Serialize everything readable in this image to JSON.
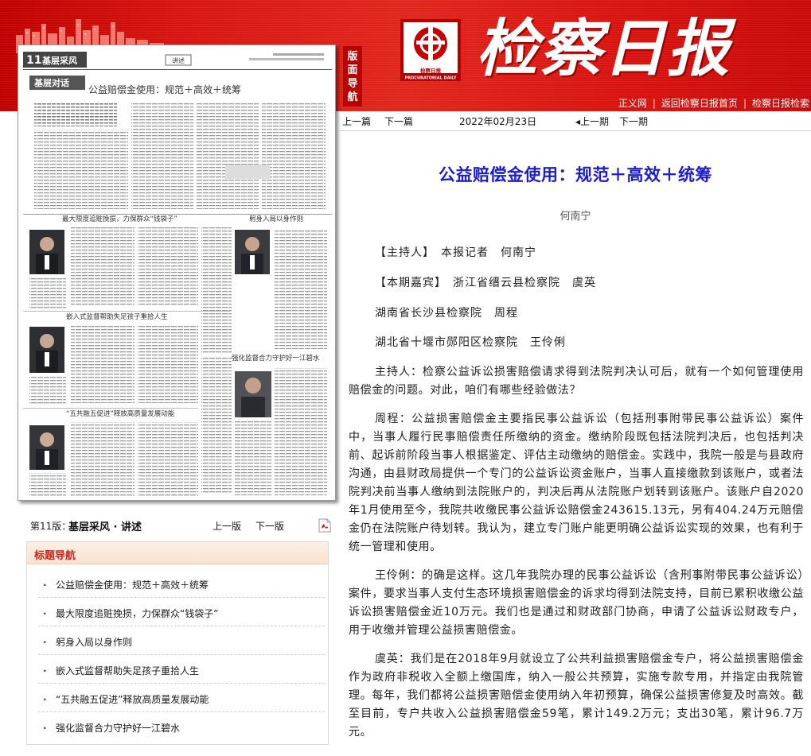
{
  "header": {
    "masthead": "检察日报",
    "logo_caption": "检察日报",
    "logo_caption_en": "PROCURATORIAL DAILY",
    "side_tab": "版面导航",
    "links": [
      "正义网",
      "返回检察日报首页",
      "检察日报检索"
    ]
  },
  "colors": {
    "header_red": "#d81410",
    "title_blue": "#1d1dcf",
    "nav_title_red": "#c8231b"
  },
  "top_nav": {
    "prev_article": "上一篇",
    "next_article": "下一篇",
    "date": "2022年02月23日",
    "prev_issue": "上一期",
    "next_issue": "下一期"
  },
  "thumbnail": {
    "page_no": "11",
    "section_name": "基层采风",
    "tag": "讲述",
    "sub_section": "基层对话",
    "headlines": [
      "公益赔偿金使用：规范＋高效＋统筹",
      "最大限度追赃挽损，力保群众“钱袋子”",
      "躬身入局以身作则",
      "嵌入式监督帮助失足孩子重拾人生",
      "强化监督合力守护好一江碧水",
      "“五共融五促进”释放高质量发展动能"
    ]
  },
  "page_info": {
    "label": "第11版：",
    "name": "基层采风 · 讲述",
    "prev": "上一版",
    "next": "下一版",
    "pdf_icon": "pdf-icon"
  },
  "title_nav": {
    "header": "标题导航",
    "items": [
      "公益赔偿金使用：规范＋高效＋统筹",
      "最大限度追赃挽损，力保群众“钱袋子”",
      "躬身入局以身作则",
      "嵌入式监督帮助失足孩子重拾人生",
      "“五共融五促进”释放高质量发展动能",
      "强化监督合力守护好一江碧水"
    ]
  },
  "article": {
    "title": "公益赔偿金使用：规范＋高效＋统筹",
    "author": "何南宁",
    "host_line": "【主持人】　本报记者　何南宁",
    "guests_line": "【本期嘉宾】　浙江省缙云县检察院　虞英",
    "guest2": "湖南省长沙县检察院　周程",
    "guest3": "湖北省十堰市郧阳区检察院　王伶俐",
    "paragraphs": [
      "主持人：检察公益诉讼损害赔偿请求得到法院判决认可后，就有一个如何管理使用赔偿金的问题。对此，咱们有哪些经验做法？",
      "周程：公益损害赔偿金主要指民事公益诉讼（包括刑事附带民事公益诉讼）案件中，当事人履行民事赔偿责任所缴纳的资金。缴纳阶段既包括法院判决后，也包括判决前、起诉前阶段当事人根据鉴定、评估主动缴纳的赔偿金。实践中，我院一般是与县政府沟通，由县财政局提供一个专门的公益诉讼资金账户，当事人直接缴款到该账户，或者法院判决前当事人缴纳到法院账户的，判决后再从法院账户划转到该账户。该账户自2020年1月使用至今，我院共收缴民事公益诉讼赔偿金243615.13元，另有404.24万元赔偿金仍在法院账户待划转。我认为，建立专门账户能更明确公益诉讼实现的效果，也有利于统一管理和使用。",
      "王伶俐：的确是这样。这几年我院办理的民事公益诉讼（含刑事附带民事公益诉讼）案件，要求当事人支付生态环境损害赔偿金的诉求均得到法院支持，目前已累积收缴公益诉讼损害赔偿金近10万元。我们也是通过和财政部门协商，申请了公益诉讼财政专户，用于收缴并管理公益损害赔偿金。",
      "虞英：我们是在2018年9月就设立了公共利益损害赔偿金专户，将公益损害赔偿金作为政府非税收入全额上缴国库，纳入一般公共预算，实施专款专用，并指定由我院管理。每年，我们都将公益损害赔偿金使用纳入年初预算，确保公益损害修复及时高效。截至目前，专户共收入公益损害赔偿金59笔，累计149.2万元；支出30笔，累计96.7万元。"
    ]
  }
}
